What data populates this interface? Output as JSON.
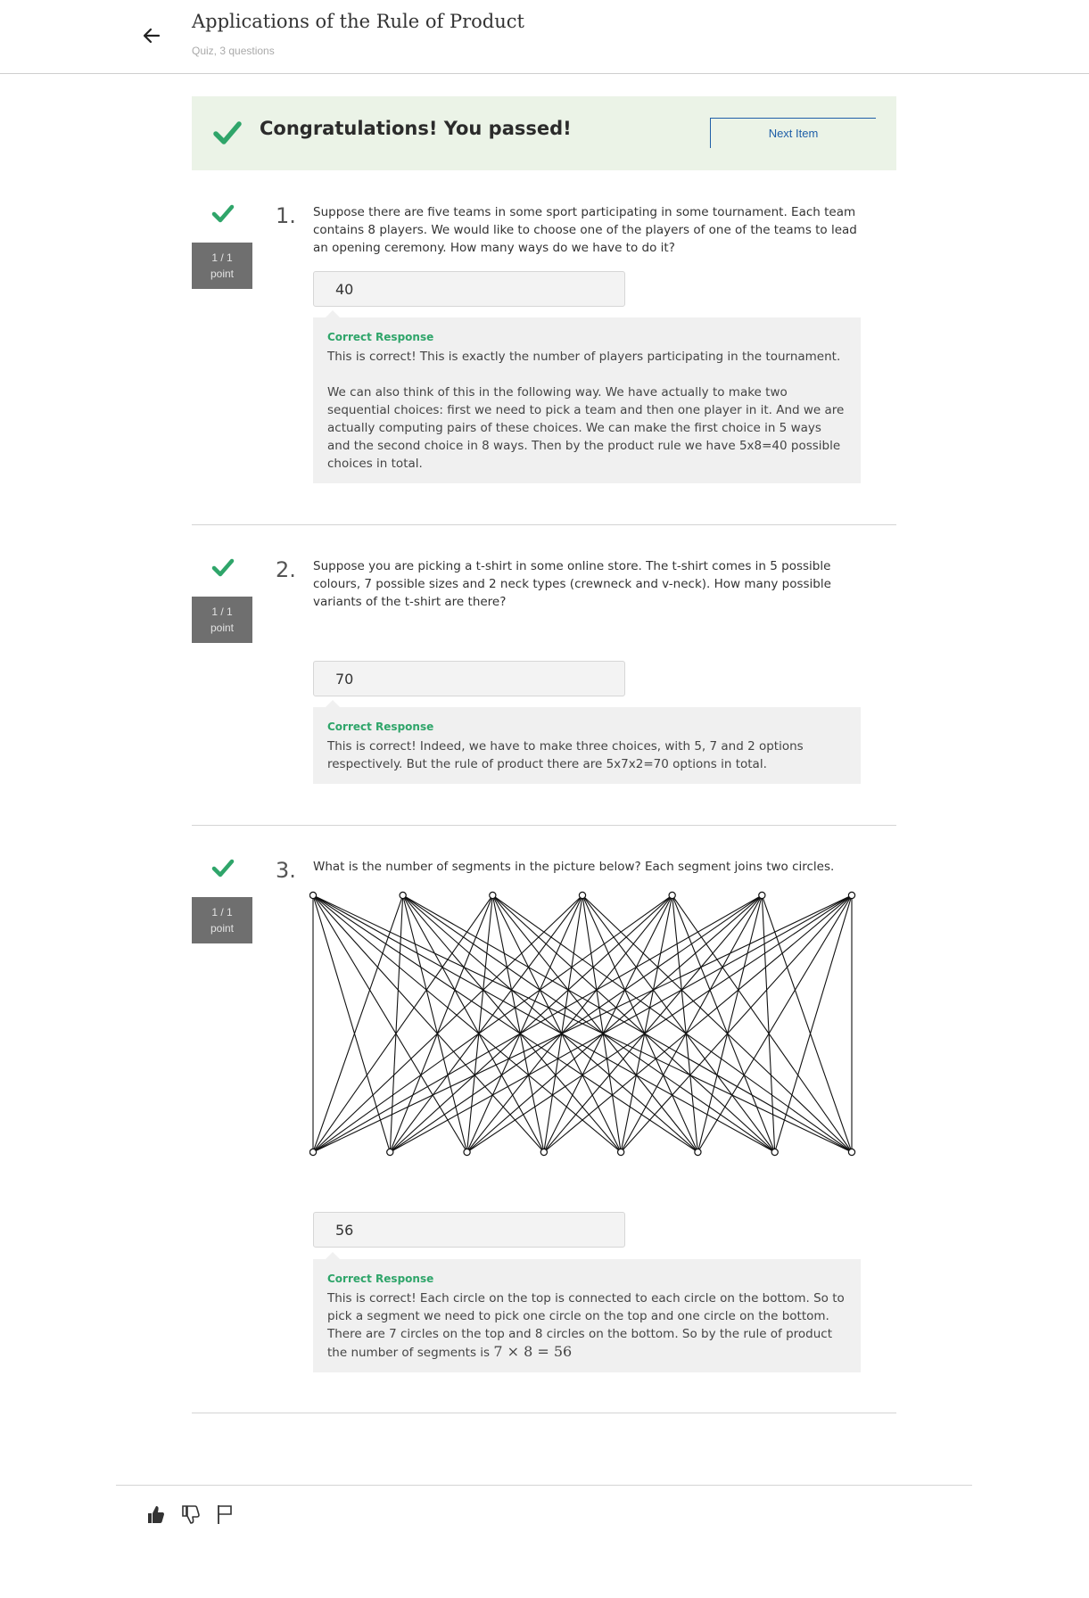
{
  "header": {
    "title": "Applications of the Rule of Product",
    "subtitle": "Quiz, 3 questions",
    "back_icon": "arrow-left-icon"
  },
  "banner": {
    "message": "Congratulations! You passed!",
    "next_label": "Next Item",
    "icon": "check-icon"
  },
  "colors": {
    "success": "#2fa56a",
    "banner_bg": "#ebf3e7",
    "link": "#1f5fa8",
    "points_bg": "#6f6f6f"
  },
  "questions": [
    {
      "number": "1.",
      "score": "1 / 1",
      "score_unit": "point",
      "text": "Suppose there are five teams in some sport participating in some tournament. Each team contains 8 players. We would like to choose one of the players of one of the teams to lead an opening ceremony. How many ways do we have to do it?",
      "answer": "40",
      "feedback_label": "Correct Response",
      "feedback": [
        "This is correct! This is exactly the number of players participating in the tournament.",
        "We can also think of this in the following way. We have actually to make two sequential choices: first we need to pick a team and then one player in it. And we are actually computing pairs of these choices. We can make the first choice in 5 ways and the second choice in 8 ways. Then by the product rule we have 5x8=40 possible choices in total."
      ]
    },
    {
      "number": "2.",
      "score": "1 / 1",
      "score_unit": "point",
      "text": "Suppose you are picking a t-shirt in some online store. The t-shirt comes in 5 possible colours, 7 possible sizes and 2 neck types (crewneck and v-neck). How many possible variants of the t-shirt are there?",
      "answer": "70",
      "feedback_label": "Correct Response",
      "feedback": [
        "This is correct! Indeed, we have to make three choices, with 5, 7 and 2 options respectively. But the rule of product there are 5x7x2=70 options in total."
      ]
    },
    {
      "number": "3.",
      "score": "1 / 1",
      "score_unit": "point",
      "text": "What is the number of segments in the picture below? Each segment joins two circles.",
      "answer": "56",
      "feedback_label": "Correct Response",
      "feedback_text": "This is correct! Each circle on the top is connected to each circle on the bottom. So to pick a segment we need to pick one circle on the top and one circle on the bottom. There are 7 circles on the top and 8 circles on the bottom. So by the rule of product the number of segments is",
      "feedback_math": "7 × 8 = 56",
      "graph": {
        "top_circles": 7,
        "bottom_circles": 8
      }
    }
  ],
  "footer": {
    "icons": [
      "thumbs-up-icon",
      "thumbs-down-icon",
      "flag-icon"
    ]
  }
}
